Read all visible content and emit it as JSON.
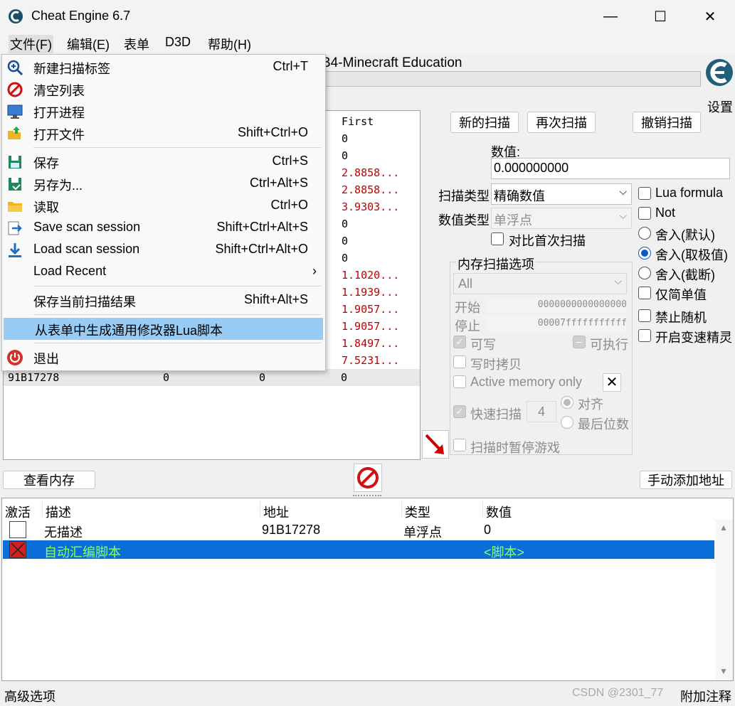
{
  "window": {
    "title": "Cheat Engine 6.7",
    "minimize": "—",
    "maximize": "☐",
    "close": "✕"
  },
  "menubar": [
    "文件(F)",
    "编辑(E)",
    "表单",
    "D3D",
    "帮助(H)"
  ],
  "process_title": "B4-Minecraft Education",
  "settings_label": "设置",
  "file_menu": [
    {
      "label": "新建扫描标签",
      "shortcut": "Ctrl+T",
      "icon": "new-scan-icon"
    },
    {
      "label": "清空列表",
      "shortcut": "",
      "icon": "clear-icon"
    },
    {
      "label": "打开进程",
      "shortcut": "",
      "icon": "monitor-icon"
    },
    {
      "label": "打开文件",
      "shortcut": "Shift+Ctrl+O",
      "icon": "folder-open-icon"
    },
    {
      "label": "保存",
      "shortcut": "Ctrl+S",
      "icon": "save-icon"
    },
    {
      "label": "另存为...",
      "shortcut": "Ctrl+Alt+S",
      "icon": "save-as-icon"
    },
    {
      "label": "读取",
      "shortcut": "Ctrl+O",
      "icon": "folder-icon"
    },
    {
      "label": "Save scan session",
      "shortcut": "Shift+Ctrl+Alt+S",
      "icon": "export-icon"
    },
    {
      "label": "Load scan session",
      "shortcut": "Shift+Ctrl+Alt+O",
      "icon": "download-icon"
    },
    {
      "label": "Load Recent",
      "shortcut": "›",
      "icon": ""
    },
    {
      "label": "保存当前扫描结果",
      "shortcut": "Shift+Alt+S",
      "icon": ""
    },
    {
      "label": "从表单中生成通用修改器Lua脚本",
      "shortcut": "",
      "icon": ""
    },
    {
      "label": "退出",
      "shortcut": "",
      "icon": "power-icon"
    }
  ],
  "results": {
    "header_first": "First",
    "first_values": [
      "0",
      "0",
      "2.8858...",
      "2.8858...",
      "3.9303...",
      "0",
      "0",
      "0",
      "1.1020...",
      "1.1939...",
      "1.9057...",
      "1.9057...",
      "1.8497...",
      "7.5231..."
    ],
    "last_row": {
      "address": "91B17278",
      "value": "0",
      "previous": "0",
      "first": "0"
    }
  },
  "buttons": {
    "new_scan": "新的扫描",
    "next_scan": "再次扫描",
    "undo_scan": "撤销扫描",
    "view_memory": "查看内存",
    "add_address": "手动添加地址"
  },
  "scan": {
    "value_label": "数值:",
    "value": "0.000000000",
    "scan_type_label": "扫描类型",
    "scan_type": "精确数值",
    "value_type_label": "数值类型",
    "value_type": "单浮点",
    "compare_first": "对比首次扫描",
    "options": [
      "Lua formula",
      "Not"
    ],
    "rounding": [
      "舍入(默认)",
      "舍入(取极值)",
      "舍入(截断)"
    ],
    "simple_only": "仅简单值",
    "no_random": "禁止随机",
    "speedhack": "开启变速精灵"
  },
  "memory_options": {
    "title": "内存扫描选项",
    "region": "All",
    "start_label": "开始",
    "start": "0000000000000000",
    "stop_label": "停止",
    "stop": "00007fffffffffff",
    "writable": "可写",
    "executable": "可执行",
    "copy_on_write": "写时拷贝",
    "active_memory": "Active memory only",
    "fast_scan": "快速扫描",
    "fast_value": "4",
    "align": "对齐",
    "last_digits": "最后位数",
    "pause": "扫描时暂停游戏"
  },
  "table": {
    "headers": [
      "激活",
      "描述",
      "地址",
      "类型",
      "数值"
    ],
    "rows": [
      {
        "desc": "无描述",
        "address": "91B17278",
        "type": "单浮点",
        "value": "0"
      },
      {
        "desc": "自动汇编脚本",
        "address": "",
        "type": "",
        "value": "<脚本>"
      }
    ]
  },
  "statusbar": {
    "left": "高级选项",
    "right": "附加注释",
    "watermark": "CSDN @2301_77"
  }
}
